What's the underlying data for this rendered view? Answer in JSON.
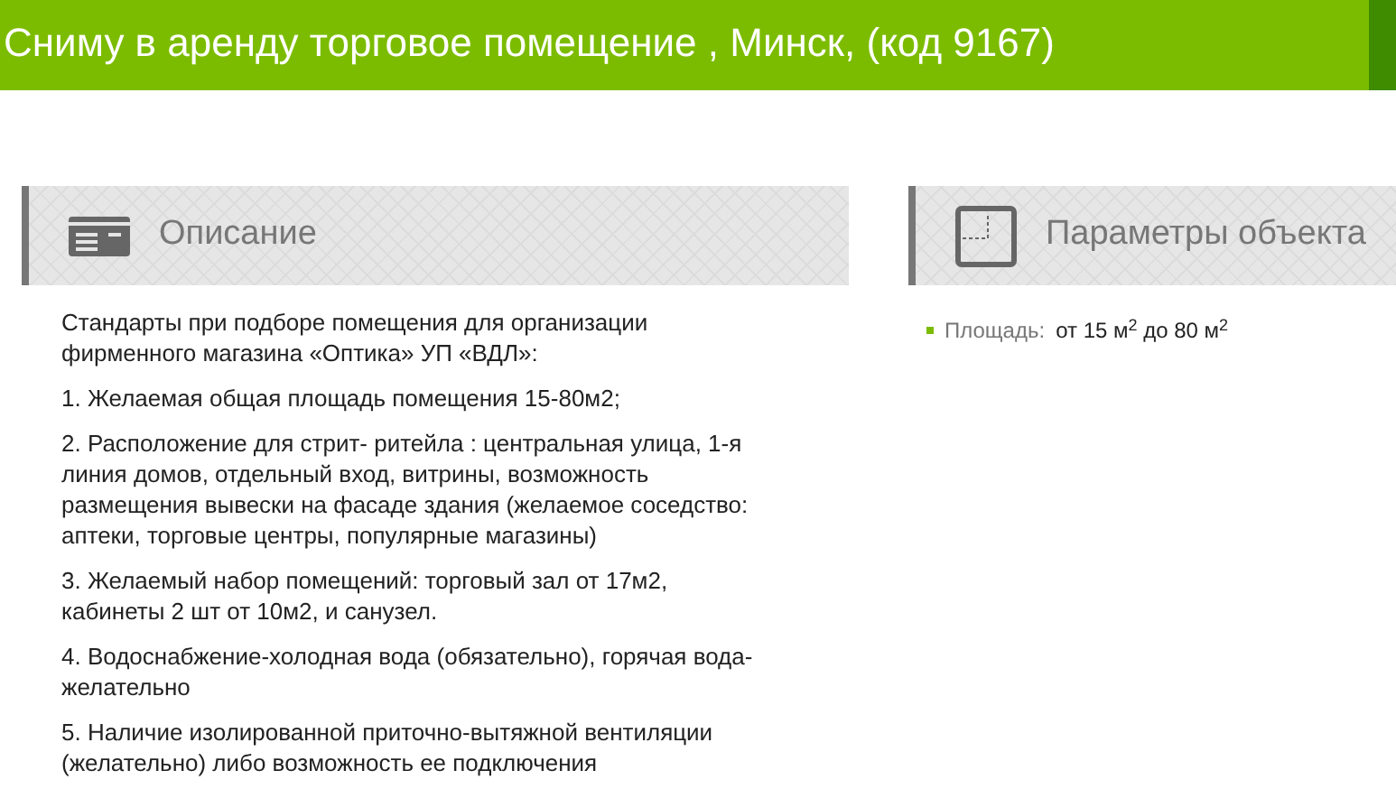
{
  "title": "Сниму в аренду торговое помещение , Минск, (код 9167)",
  "description": {
    "heading": "Описание",
    "paragraphs": [
      "Стандарты при подборе помещения для организации фирменного магазина «Оптика» УП «ВДЛ»:",
      "1. Желаемая общая площадь помещения 15-80м2;",
      "2. Расположение для стрит- ритейла : центральная улица, 1-я линия домов, отдельный вход, витрины, возможность размещения вывески на фасаде здания (желаемое соседство: аптеки, торговые центры, популярные магазины)",
      "3. Желаемый набор помещений: торговый зал от 17м2, кабинеты 2 шт от 10м2, и санузел.",
      "4. Водоснабжение-холодная вода (обязательно), горячая вода-желательно",
      "5. Наличие изолированной приточно-вытяжной вентиляции (желательно) либо возможность ее подключения"
    ]
  },
  "parameters": {
    "heading": "Параметры объекта",
    "items": [
      {
        "label": "Площадь:",
        "value": "от 15 м$^{2}$ до 80 м$^{2}$"
      }
    ]
  }
}
